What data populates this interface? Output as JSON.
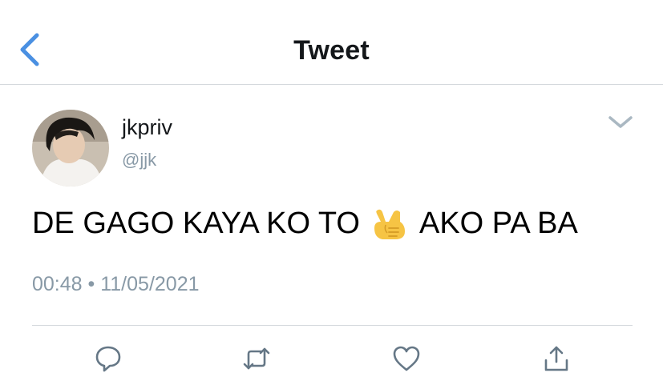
{
  "header": {
    "title": "Tweet",
    "back_icon": "chevron-left-icon",
    "accent_color": "#4a90e2"
  },
  "tweet": {
    "user": {
      "display_name": "jkpriv",
      "handle": "@jjk",
      "avatar": "avatar-photo"
    },
    "menu_icon": "chevron-down-icon",
    "text_before": "DE GAGO KAYA KO TO",
    "emoji": "call-me-hand-emoji",
    "text_after": "AKO PA BA",
    "time": "00:48",
    "separator": "•",
    "date": "11/05/2021",
    "muted_color": "#8899a6"
  },
  "actions": [
    {
      "icon": "reply-icon"
    },
    {
      "icon": "retweet-icon"
    },
    {
      "icon": "like-icon"
    },
    {
      "icon": "share-icon"
    }
  ]
}
